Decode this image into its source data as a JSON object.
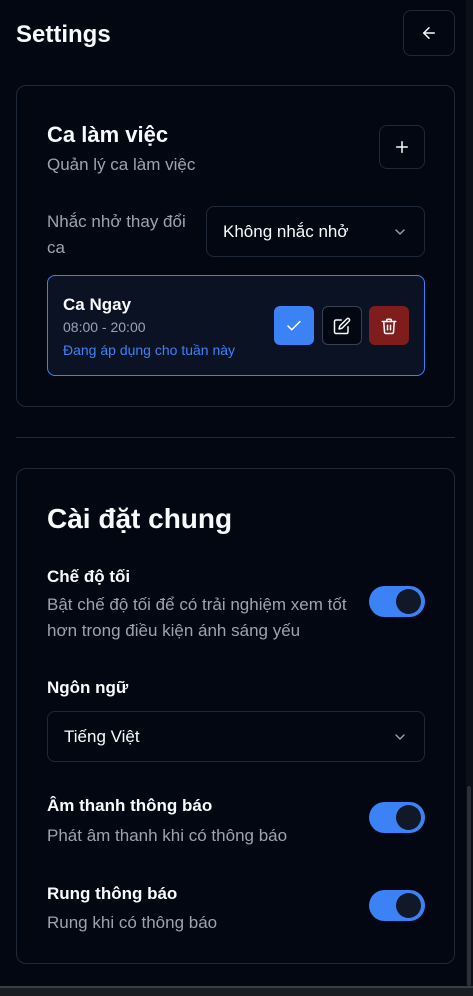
{
  "header": {
    "title": "Settings",
    "back_icon": "arrow-left-icon"
  },
  "shift_card": {
    "title": "Ca làm việc",
    "subtitle": "Quản lý ca làm việc",
    "add_icon": "plus-icon",
    "reminder": {
      "label": "Nhắc nhở thay đổi ca",
      "selected": "Không nhắc nhở"
    },
    "shifts": [
      {
        "name": "Ca Ngay",
        "time": "08:00 - 20:00",
        "status": "Đang áp dụng cho tuần này",
        "actions": [
          "check-icon",
          "edit-icon",
          "trash-icon"
        ]
      }
    ]
  },
  "general_card": {
    "title": "Cài đặt chung",
    "dark_mode": {
      "label": "Chế độ tối",
      "description": "Bật chế độ tối để có trải nghiệm xem tốt hơn trong điều kiện ánh sáng yếu",
      "enabled": true
    },
    "language": {
      "label": "Ngôn ngữ",
      "selected": "Tiếng Việt"
    },
    "notification_sound": {
      "label": "Âm thanh thông báo",
      "description": "Phát âm thanh khi có thông báo",
      "enabled": true
    },
    "vibration": {
      "label": "Rung thông báo",
      "description": "Rung khi có thông báo",
      "enabled": true
    }
  },
  "colors": {
    "background": "#030712",
    "accent": "#3b82f6",
    "danger": "#7f1d1d",
    "muted_text": "#9ca3af",
    "border": "#1f2937"
  }
}
